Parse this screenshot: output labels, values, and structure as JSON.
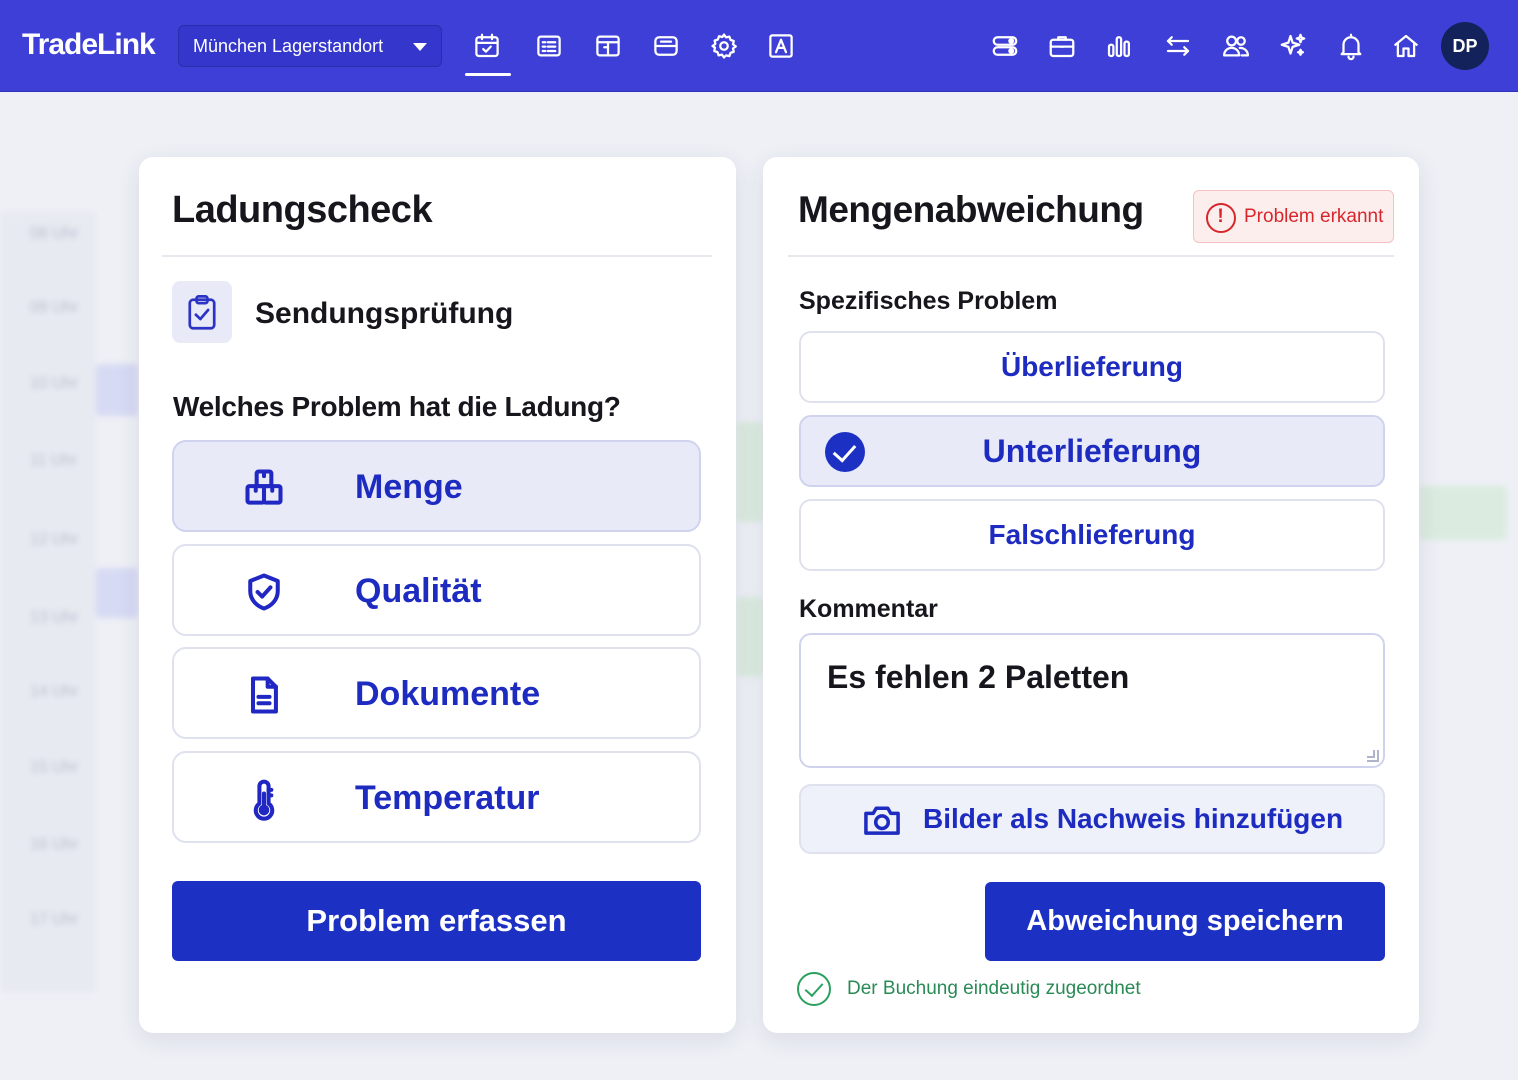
{
  "app": {
    "logo": "TradeLink",
    "location_selector": "München Lagerstandort",
    "user_initials": "DP",
    "nav_icons": [
      "calendar-icon",
      "list-icon",
      "dashboard-icon",
      "database-icon",
      "gear-icon",
      "text-recognition-icon"
    ],
    "right_icons": [
      "toggle-icon",
      "briefcase-icon",
      "chart-icon",
      "transfer-icon",
      "users-icon",
      "sparkle-icon",
      "bell-icon",
      "home-icon"
    ]
  },
  "background": {
    "hours": [
      "08 Uhr",
      "09 Uhr",
      "10 Uhr",
      "11 Uhr",
      "12 Uhr",
      "13 Uhr",
      "14 Uhr",
      "15 Uhr",
      "16 Uhr",
      "17 Uhr"
    ]
  },
  "left_card": {
    "title": "Ladungscheck",
    "subtitle": "Sendungsprüfung",
    "question": "Welches Problem hat die Ladung?",
    "options": [
      {
        "label": "Menge",
        "icon": "boxes-icon",
        "selected": true
      },
      {
        "label": "Qualität",
        "icon": "shield-check-icon",
        "selected": false
      },
      {
        "label": "Dokumente",
        "icon": "document-icon",
        "selected": false
      },
      {
        "label": "Temperatur",
        "icon": "thermometer-icon",
        "selected": false
      }
    ],
    "submit_label": "Problem erfassen"
  },
  "right_card": {
    "title": "Mengenabweichung",
    "status_badge": "Problem erkannt",
    "specific_label": "Spezifisches Problem",
    "options": [
      {
        "label": "Überlieferung",
        "selected": false
      },
      {
        "label": "Unterlieferung",
        "selected": true
      },
      {
        "label": "Falschlieferung",
        "selected": false
      }
    ],
    "comment_label": "Kommentar",
    "comment_value": "Es fehlen 2 Paletten",
    "photo_label": "Bilder als Nachweis hinzufügen",
    "save_label": "Abweichung speichern",
    "confirmation": "Der Buchung eindeutig zugeordnet"
  },
  "colors": {
    "topbar": "#3d3fd6",
    "primary": "#1c31c4",
    "selected_bg": "#e8eaf8",
    "alert": "#d7262c",
    "success": "#2aa05e"
  }
}
